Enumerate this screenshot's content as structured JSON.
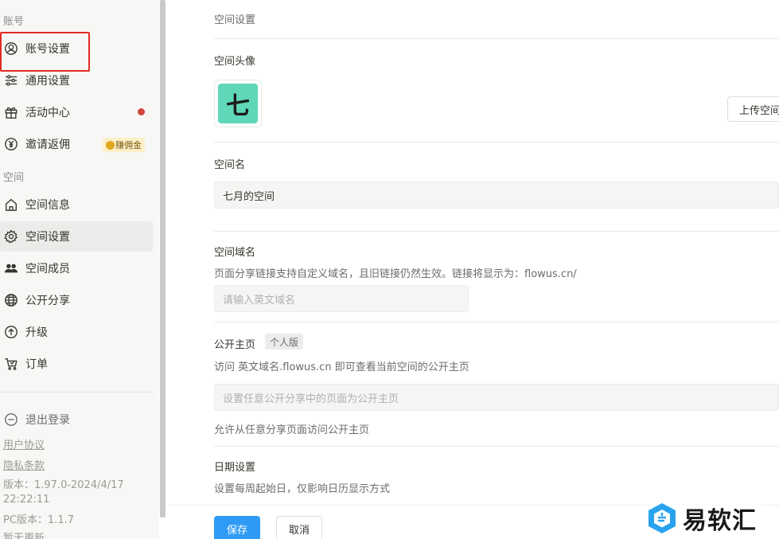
{
  "sidebar": {
    "account_section": "账号",
    "account_items": [
      {
        "label": "账号设置",
        "icon": "user-circle-icon"
      },
      {
        "label": "通用设置",
        "icon": "sliders-icon"
      },
      {
        "label": "活动中心",
        "icon": "gift-icon"
      },
      {
        "label": "邀请返佣",
        "icon": "yen-icon",
        "badge": "赚佣金"
      }
    ],
    "space_section": "空间",
    "space_items": [
      {
        "label": "空间信息",
        "icon": "home-icon"
      },
      {
        "label": "空间设置",
        "icon": "gear-icon",
        "active": true
      },
      {
        "label": "空间成员",
        "icon": "users-icon"
      },
      {
        "label": "公开分享",
        "icon": "globe-icon"
      },
      {
        "label": "升级",
        "icon": "arrow-up-circle-icon"
      },
      {
        "label": "订单",
        "icon": "cart-icon"
      }
    ],
    "logout": "退出登录",
    "user_agreement": "用户协议",
    "privacy_policy": "隐私条款",
    "version_line1": "版本：1.97.0-2024/4/17",
    "version_line2": "22:22:11",
    "pc_version": "PC版本：1.1.7",
    "cut_text": "暂无更新"
  },
  "main": {
    "breadcrumb": "空间设置",
    "avatar_title": "空间头像",
    "avatar_char": "七",
    "upload_button": "上传空间头像",
    "name_title": "空间名",
    "name_value": "七月的空间",
    "domain_title": "空间域名",
    "domain_desc": "页面分享链接支持自定义域名，且旧链接仍然生效。链接将显示为：flowus.cn/",
    "domain_placeholder": "请输入英文域名",
    "homepage_title": "公开主页",
    "homepage_tag": "个人版",
    "homepage_desc": "访问 英文域名.flowus.cn 即可查看当前空间的公开主页",
    "homepage_placeholder": "设置任意公开分享中的页面为公开主页",
    "homepage_note": "允许从任意分享页面访问公开主页",
    "date_title": "日期设置",
    "date_desc": "设置每周起始日，仅影响日历显示方式",
    "save": "保存",
    "cancel": "取消"
  },
  "watermark": {
    "text": "易软汇"
  },
  "colors": {
    "accent": "#2f9bf5",
    "avatar_bg": "#5fd7b8",
    "highlight": "#e02b24",
    "dot": "#d0453c"
  }
}
